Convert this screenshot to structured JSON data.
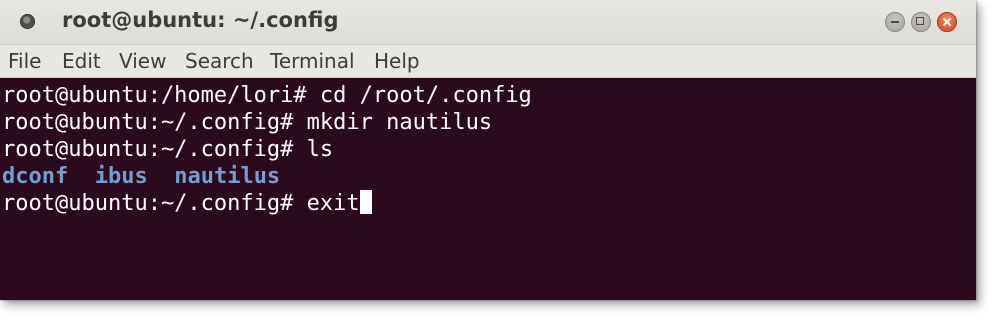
{
  "window": {
    "title": "root@ubuntu: ~/.config",
    "title_icon": "terminal-app-icon",
    "controls": [
      "minimize-icon",
      "maximize-icon",
      "close-icon"
    ]
  },
  "menu": {
    "items": [
      "File",
      "Edit",
      "View",
      "Search",
      "Terminal",
      "Help"
    ]
  },
  "terminal": {
    "background": "#2c0a1e",
    "foreground": "#ffffff",
    "directory_color": "#729fcf",
    "lines": [
      "root@ubuntu:/home/lori# cd /root/.config",
      "root@ubuntu:~/.config# mkdir nautilus",
      "root@ubuntu:~/.config# ls"
    ],
    "ls_output": [
      "dconf",
      "ibus",
      "nautilus"
    ],
    "prompt": "root@ubuntu:~/.config# ",
    "current_input": "exit"
  }
}
